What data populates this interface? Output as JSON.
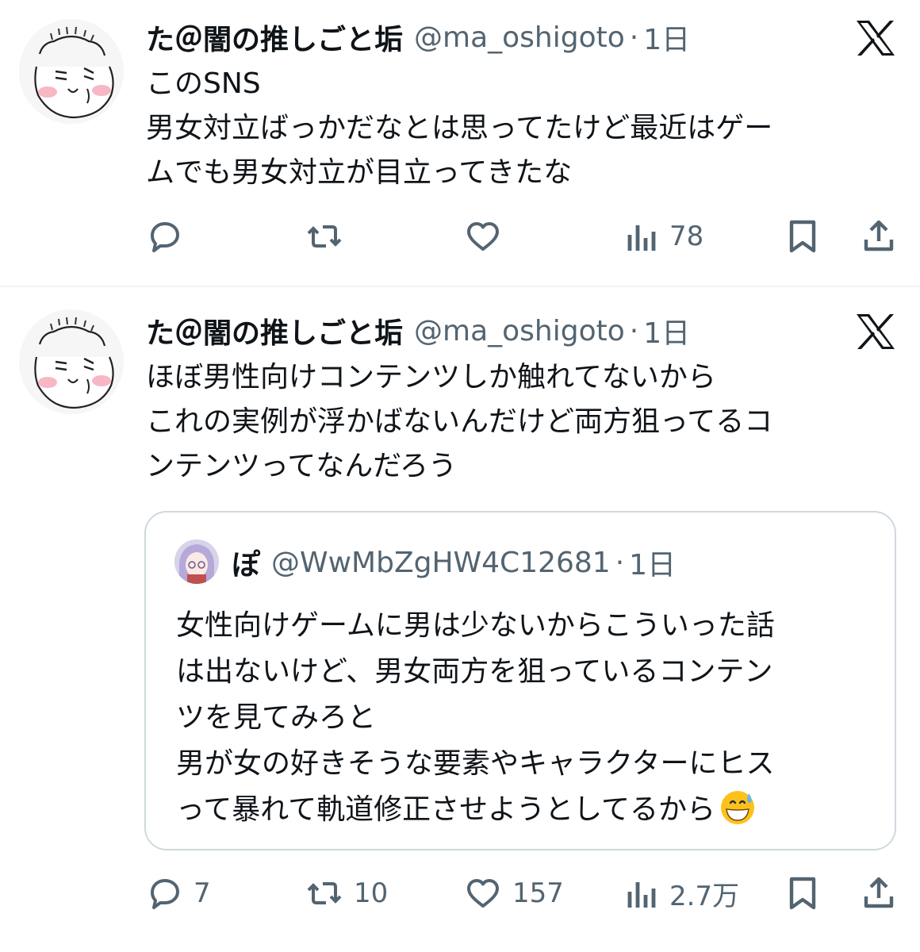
{
  "tweets": [
    {
      "author": {
        "display_name": "た＠闇の推しごと垢",
        "handle": "@ma_oshigoto",
        "separator": "·",
        "time": "1日"
      },
      "text_lines": [
        "このSNS",
        "男女対立ばっかだなとは思ってたけど最近はゲー",
        "ムでも男女対立が目立ってきたな"
      ],
      "actions": {
        "replies": "",
        "reposts": "",
        "likes": "",
        "views": "78"
      }
    },
    {
      "author": {
        "display_name": "た＠闇の推しごと垢",
        "handle": "@ma_oshigoto",
        "separator": "·",
        "time": "1日"
      },
      "text_lines": [
        "ほぼ男性向けコンテンツしか触れてないから",
        "これの実例が浮かばないんだけど両方狙ってるコ",
        "ンテンツってなんだろう"
      ],
      "quote": {
        "author": {
          "display_name": "ぽ",
          "handle": "@WwMbZgHW4C12681",
          "separator": "·",
          "time": "1日"
        },
        "text_lines": [
          "女性向けゲームに男は少ないからこういった話",
          "は出ないけど、男女両方を狙っているコンテン",
          "ツを見てみろと",
          "男が女の好きそうな要素やキャラクターにヒス",
          "って暴れて軌道修正させようとしてるから"
        ],
        "trailing_emoji": "grinning-face-with-sweat-emoji"
      },
      "actions": {
        "replies": "7",
        "reposts": "10",
        "likes": "157",
        "views": "2.7万"
      }
    }
  ],
  "icons": {
    "platform_logo": "x-logo",
    "reply": "reply-icon",
    "repost": "repost-icon",
    "like": "heart-icon",
    "views": "views-icon",
    "bookmark": "bookmark-icon",
    "share": "share-icon"
  },
  "colors": {
    "text": "#0f1419",
    "secondary_text": "#536471",
    "border": "#cfd9de",
    "divider": "#eff3f4"
  }
}
